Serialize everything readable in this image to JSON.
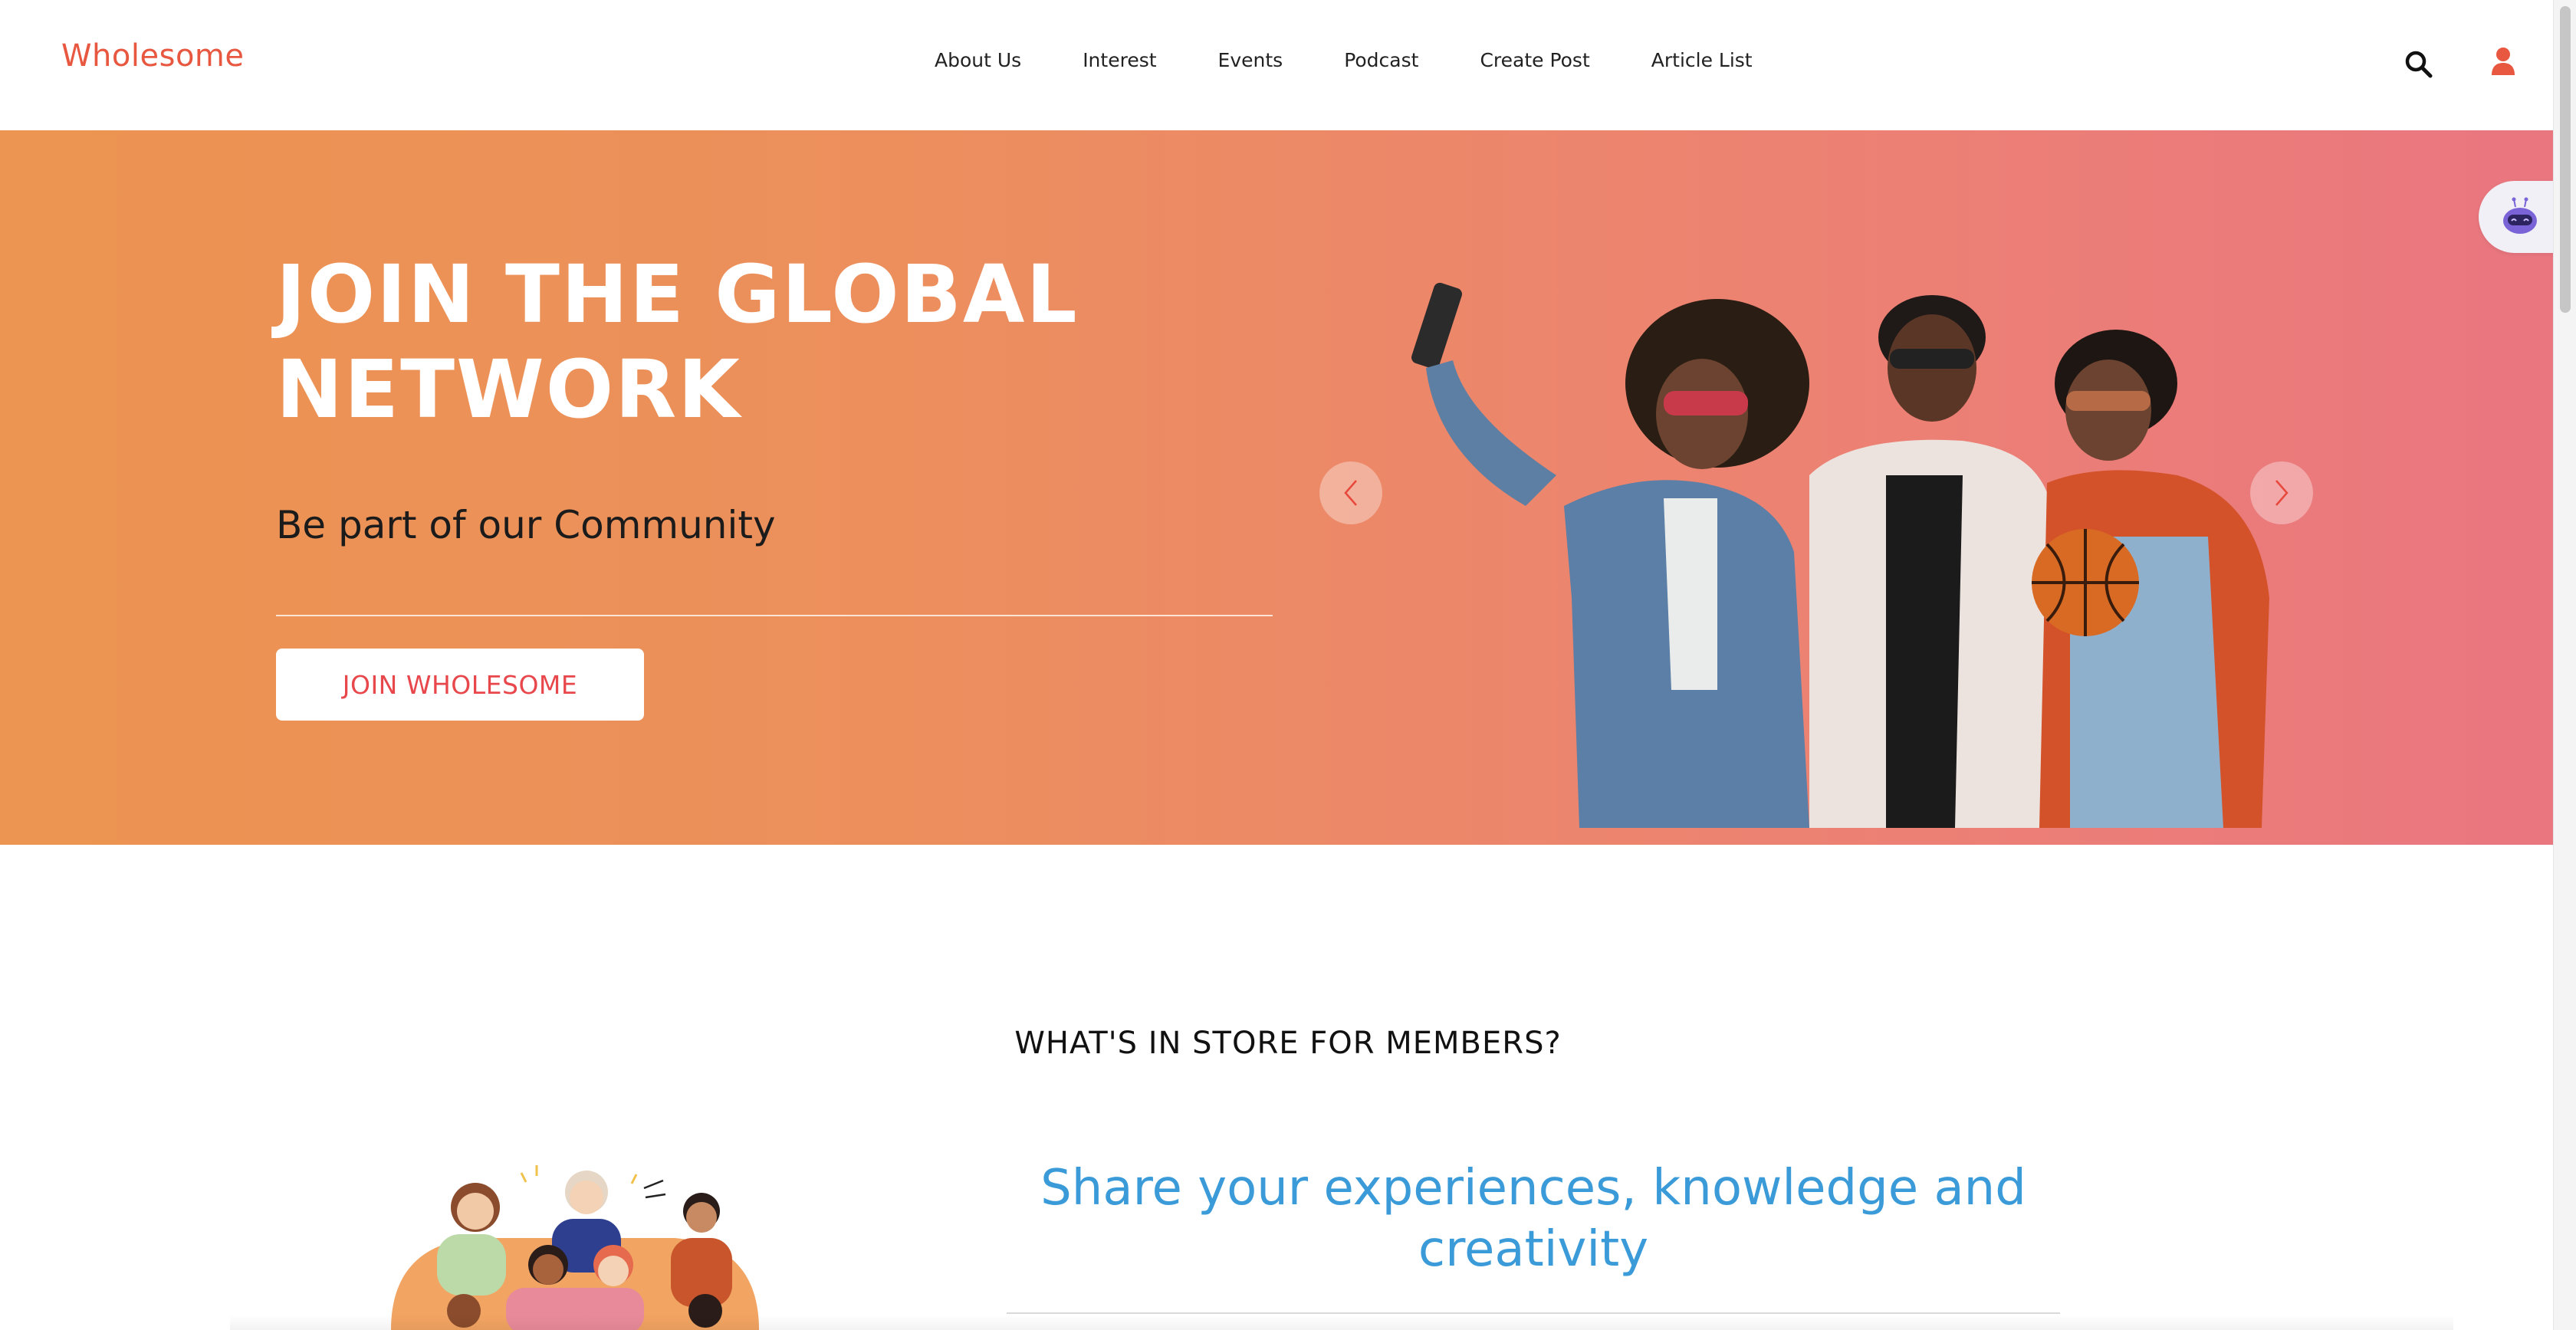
{
  "header": {
    "logo": "Wholesome",
    "nav": [
      "About Us",
      "Interest",
      "Events",
      "Podcast",
      "Create Post",
      "Article List"
    ],
    "icons": {
      "search": "search-icon",
      "user": "user-icon"
    }
  },
  "hero": {
    "title": "JOIN THE GLOBAL NETWORK",
    "subtitle": "Be part of our Community",
    "cta": "JOIN WHOLESOME",
    "icons": {
      "prev": "chevron-left-icon",
      "next": "chevron-right-icon"
    },
    "colors": {
      "gradient_start": "#ec9451",
      "gradient_end": "#ea7680",
      "cta_text": "#e8474b"
    }
  },
  "chatbot": {
    "icon": "robot-icon"
  },
  "members": {
    "heading": "WHAT'S IN STORE FOR MEMBERS?",
    "feature_title": "Share your experiences, knowledge and creativity"
  },
  "colors": {
    "brand": "#e8573f",
    "accent_blue": "#3b9bd9"
  }
}
